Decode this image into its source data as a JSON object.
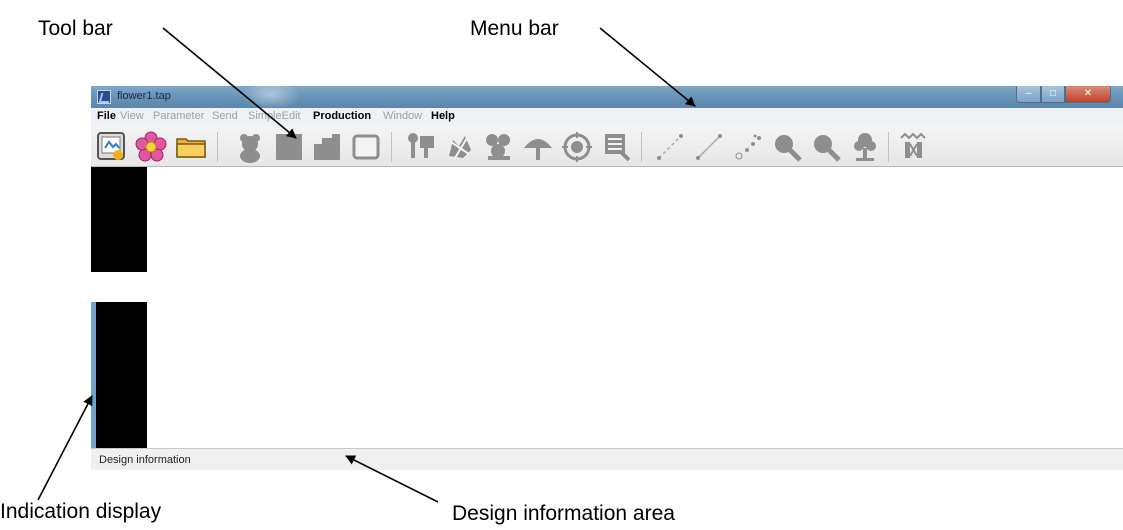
{
  "callouts": {
    "tool_bar": "Tool bar",
    "menu_bar": "Menu bar",
    "indication_display": "Indication display",
    "design_information_area": "Design information area"
  },
  "window": {
    "title": "flower1.tap"
  },
  "menu": [
    {
      "label": "File",
      "enabled": true
    },
    {
      "label": "View",
      "enabled": false
    },
    {
      "label": "Parameter",
      "enabled": false
    },
    {
      "label": "Send",
      "enabled": false
    },
    {
      "label": "SimpleEdit",
      "enabled": false
    },
    {
      "label": "Production",
      "enabled": true
    },
    {
      "label": "Window",
      "enabled": false
    },
    {
      "label": "Help",
      "enabled": true
    }
  ],
  "toolbar_icons": [
    "new-design-icon",
    "flower-icon",
    "open-folder-icon",
    "bear-icon",
    "square-icon",
    "shape-icon",
    "frame-icon",
    "pin-icon",
    "embroidery-icon",
    "cluster-icon",
    "umbrella-icon",
    "target-icon",
    "stamp-icon",
    "line-icon",
    "line2-icon",
    "scatter-icon",
    "zoom-in-icon",
    "zoom-out-icon",
    "tree-icon",
    "stitch-icon"
  ],
  "statusbar": {
    "text": "Design information"
  },
  "colors": {
    "titlebar": "#6793b8",
    "menubar": "#eef1f5",
    "indication_display": "#000000",
    "indicator_strip": "#6fa4c8"
  }
}
